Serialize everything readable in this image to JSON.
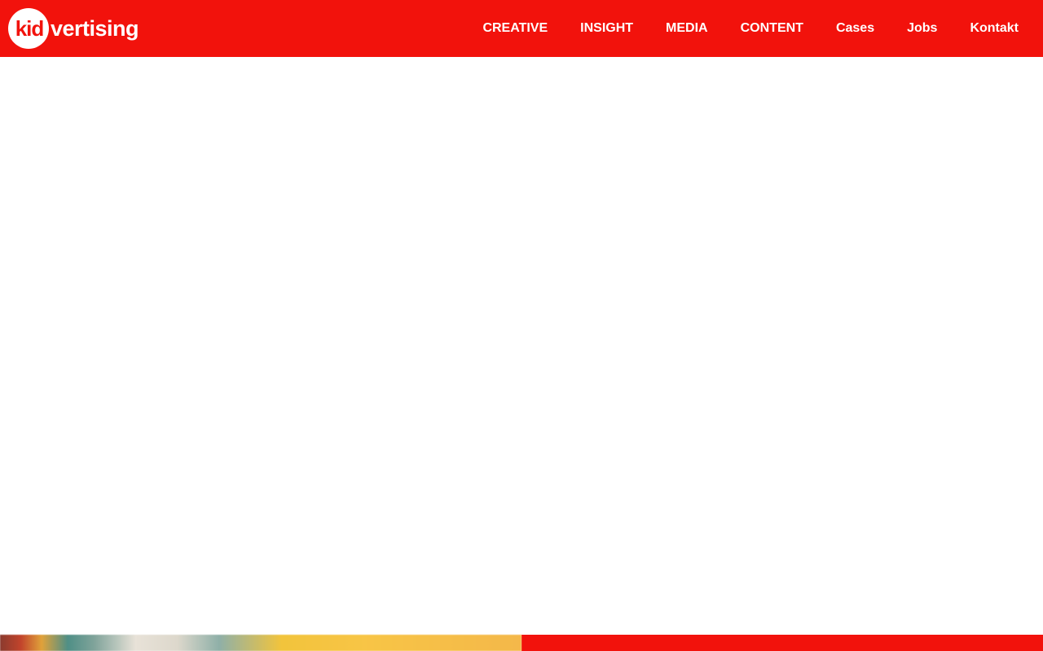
{
  "colors": {
    "brand_red": "#f2120c",
    "text_on_brand": "#ffffff",
    "page_background": "#ffffff"
  },
  "header": {
    "logo": {
      "circle_text": "kid",
      "rest_text": "vertising"
    },
    "nav": [
      {
        "label": "CREATIVE"
      },
      {
        "label": "INSIGHT"
      },
      {
        "label": "MEDIA"
      },
      {
        "label": "CONTENT"
      },
      {
        "label": "Cases"
      },
      {
        "label": "Jobs"
      },
      {
        "label": "Kontakt"
      }
    ]
  }
}
